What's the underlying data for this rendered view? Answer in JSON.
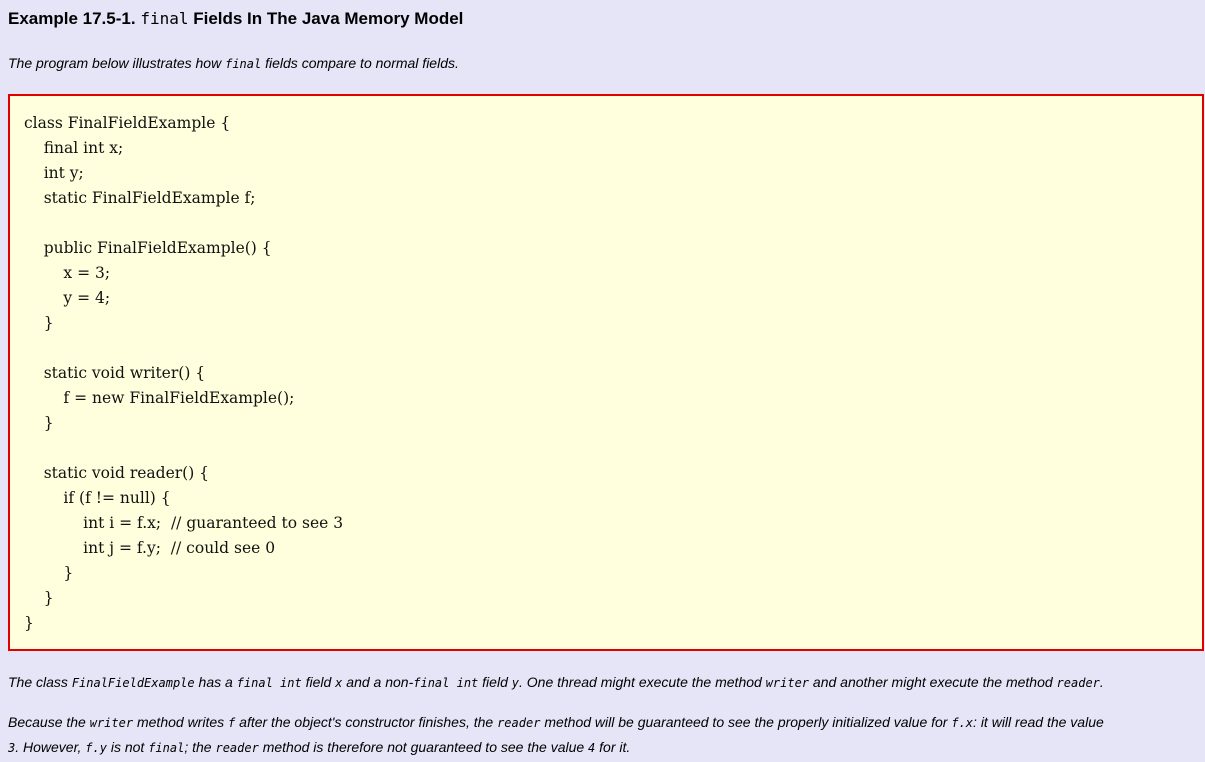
{
  "example": {
    "title_prefix": "Example 17.5-1. ",
    "title_code": "final",
    "title_suffix": " Fields In The Java Memory Model"
  },
  "intro": {
    "before": "The program below illustrates how ",
    "code": "final",
    "after": " fields compare to normal fields."
  },
  "code_lines": [
    "class FinalFieldExample {",
    "    final int x;",
    "    int y;",
    "    static FinalFieldExample f;",
    "",
    "    public FinalFieldExample() {",
    "        x = 3;",
    "        y = 4;",
    "    }",
    "",
    "    static void writer() {",
    "        f = new FinalFieldExample();",
    "    }",
    "",
    "    static void reader() {",
    "        if (f != null) {",
    "            int i = f.x;  // guaranteed to see 3",
    "            int j = f.y;  // could see 0",
    "        }",
    "    }",
    "}"
  ],
  "para1": {
    "t1": "The class ",
    "c1": "FinalFieldExample",
    "t2": " has a ",
    "c2": "final int",
    "t3": " field ",
    "c3": "x",
    "t4": " and a non-",
    "c4": "final int",
    "t5": " field ",
    "c5": "y",
    "t6": ". One thread might execute the method ",
    "c6": "writer",
    "t7": " and another might execute the method ",
    "c7": "reader",
    "t8": "."
  },
  "para2": {
    "t1": "Because the ",
    "c1": "writer",
    "t2": " method writes ",
    "c2": "f",
    "t3": " after the object's constructor finishes, the ",
    "c3": "reader",
    "t4": " method will be guaranteed to see the properly initialized value for ",
    "c4": "f.x",
    "t5": ": it will read the value",
    "c5": "3",
    "t6": ". However, ",
    "c6": "f.y",
    "t7": " is not ",
    "c7": "final",
    "t8": "; the ",
    "c8": "reader",
    "t9": " method is therefore not guaranteed to see the value ",
    "c9": "4",
    "t10": " for it."
  }
}
